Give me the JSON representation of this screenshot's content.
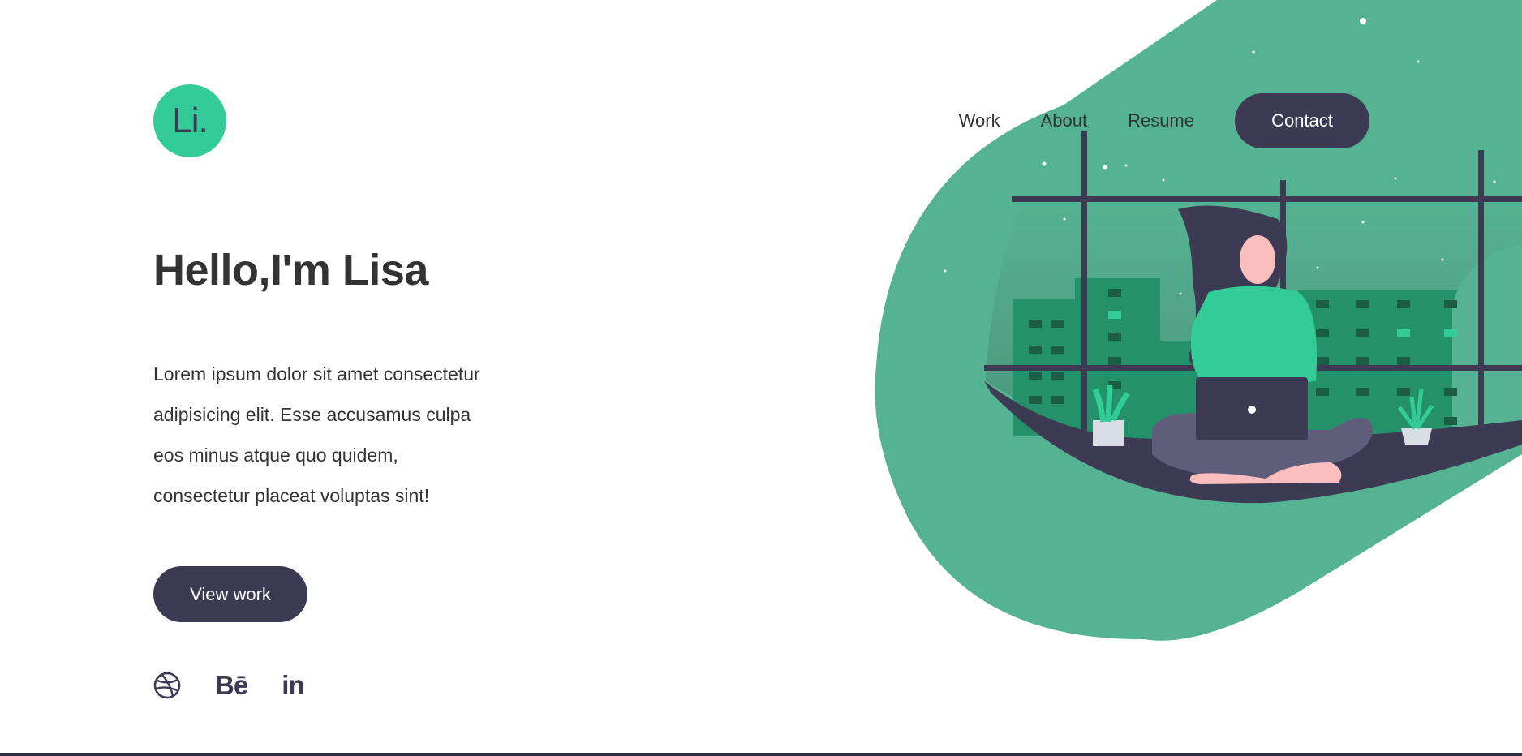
{
  "logo": {
    "text": "Li."
  },
  "nav": {
    "links": [
      {
        "label": "Work"
      },
      {
        "label": "About"
      },
      {
        "label": "Resume"
      }
    ],
    "contact_label": "Contact"
  },
  "hero": {
    "title": "Hello,I'm Lisa",
    "text_lines": [
      "Lorem ipsum dolor sit amet consectetur",
      "adipisicing elit. Esse accusamus culpa",
      "eos minus atque quo quidem,",
      "consectetur placeat voluptas sint!"
    ],
    "cta_label": "View work"
  },
  "social": {
    "dribbble_icon": "dribbble-icon",
    "behance_text": "Bē",
    "linkedin_text": "in"
  },
  "colors": {
    "accent": "#33cc99",
    "blob": "#55b292",
    "dark": "#3d3b54",
    "text": "#333333"
  }
}
